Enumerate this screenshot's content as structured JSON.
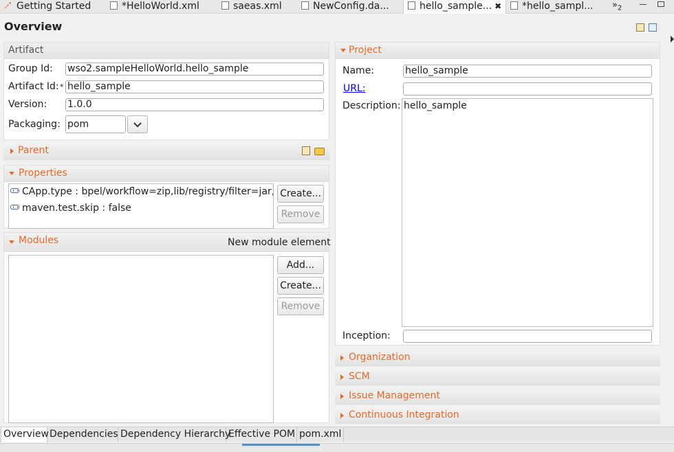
{
  "tabs": [
    {
      "label": "Getting Started",
      "icon": "rocket-icon"
    },
    {
      "label": "*HelloWorld.xml",
      "icon": "xml-file-icon"
    },
    {
      "label": "saeas.xml",
      "icon": "xml-file-icon"
    },
    {
      "label": "NewConfig.da...",
      "icon": "file-icon"
    },
    {
      "label": "hello_sample...",
      "icon": "maven-pom-icon",
      "active": true,
      "close": "✖"
    },
    {
      "label": "*hello_sampl...",
      "icon": "file-icon"
    }
  ],
  "overflow_label": "»",
  "overflow_count": "2",
  "page_title": "Overview",
  "artifact": {
    "title": "Artifact",
    "group_id_label": "Group Id:",
    "group_id": "wso2.sampleHelloWorld.hello_sample",
    "artifact_id_label": "Artifact Id:",
    "required_mark": "*",
    "artifact_id": "hello_sample",
    "version_label": "Version:",
    "version": "1.0.0",
    "packaging_label": "Packaging:",
    "packaging": "pom"
  },
  "parent": {
    "title": "Parent"
  },
  "properties": {
    "title": "Properties",
    "items": [
      "CApp.type : bpel/workflow=zip,lib/registry/filter=jar,w",
      "maven.test.skip : false"
    ],
    "create_label": "Create...",
    "remove_label": "Remove"
  },
  "modules": {
    "title": "Modules",
    "new_element_label": "New module element",
    "add_label": "Add...",
    "create_label": "Create...",
    "remove_label": "Remove"
  },
  "project": {
    "title": "Project",
    "name_label": "Name:",
    "name": "hello_sample",
    "url_label": "URL:",
    "url": "",
    "description_label": "Description:",
    "description": "hello_sample",
    "inception_label": "Inception:",
    "inception": ""
  },
  "collapsed_sections": [
    "Organization",
    "SCM",
    "Issue Management",
    "Continuous Integration"
  ],
  "bottom_tabs": [
    "Overview",
    "Dependencies",
    "Dependency Hierarchy",
    "Effective POM",
    "pom.xml"
  ],
  "colors": {
    "section_title": "#e36b2e",
    "link": "#0000ee"
  }
}
